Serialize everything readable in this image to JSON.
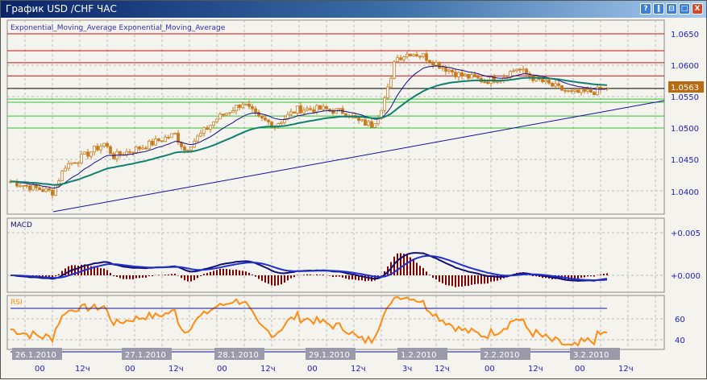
{
  "window": {
    "title": "График USD /CHF  ЧАС",
    "buttons": [
      "?",
      "‖",
      "⊟",
      "□",
      "X"
    ]
  },
  "colors": {
    "candle": "#c87818",
    "ema_fast": "#10108a",
    "ema_slow": "#108070",
    "resistance": "#d01010",
    "support": "#30c030",
    "trend": "#1010a0",
    "macd": "#101070",
    "signal": "#2030d0",
    "histogram": "#800000",
    "rsi": "#ff8c10",
    "rsi_over": "#ff20ff",
    "price_badge": "#b86a10"
  },
  "main_pane": {
    "legend": "Exponential_Moving_Average Exponential_Moving_Average",
    "price_ticks": [
      "1.0650",
      "1.0600",
      "1.0550",
      "1.0500",
      "1.0450",
      "1.0400"
    ],
    "current_price": "1.0563"
  },
  "macd_pane": {
    "label": "MACD",
    "ticks": [
      "+0.005",
      "+0.000"
    ]
  },
  "rsi_pane": {
    "label": "RSI",
    "ticks": [
      "60",
      "40"
    ]
  },
  "dates": [
    "26.1.2010",
    "27.1.2010",
    "28.1.2010",
    "29.1.2010",
    "1.2.2010",
    "2.2.2010",
    "3.2.2010"
  ],
  "times": [
    "00",
    "12ч",
    "00",
    "12ч",
    "00",
    "12ч",
    "00",
    "12ч",
    "3ч",
    "12ч",
    "00",
    "12ч",
    "00",
    "12ч"
  ],
  "chart_data": {
    "type": "candlestick",
    "symbol": "USD/CHF",
    "timeframe": "ЧАС",
    "ylim": [
      1.0375,
      1.0665
    ],
    "levels": {
      "red": [
        1.065,
        1.0623,
        1.0604,
        1.0583
      ],
      "black": [
        1.0563
      ],
      "green": [
        1.0546,
        1.0541,
        1.0519,
        1.05
      ]
    },
    "close_keypoints": [
      [
        0,
        1.0415
      ],
      [
        7,
        1.0405
      ],
      [
        13,
        1.0398
      ],
      [
        17,
        1.044
      ],
      [
        21,
        1.045
      ],
      [
        29,
        1.0475
      ],
      [
        32,
        1.0455
      ],
      [
        41,
        1.047
      ],
      [
        51,
        1.049
      ],
      [
        54,
        1.0465
      ],
      [
        64,
        1.0515
      ],
      [
        72,
        1.054
      ],
      [
        77,
        1.0515
      ],
      [
        82,
        1.0505
      ],
      [
        89,
        1.053
      ],
      [
        97,
        1.053
      ],
      [
        104,
        1.0525
      ],
      [
        108,
        1.051
      ],
      [
        112,
        1.0505
      ],
      [
        114,
        1.052
      ],
      [
        118,
        1.0575
      ],
      [
        119,
        1.061
      ],
      [
        124,
        1.062
      ],
      [
        128,
        1.0615
      ],
      [
        133,
        1.06
      ],
      [
        139,
        1.0585
      ],
      [
        147,
        1.0575
      ],
      [
        152,
        1.058
      ],
      [
        157,
        1.0595
      ],
      [
        162,
        1.058
      ],
      [
        169,
        1.0565
      ],
      [
        174,
        1.0555
      ],
      [
        181,
        1.0558
      ],
      [
        185,
        1.0563
      ]
    ],
    "rsi_levels": [
      70,
      30
    ]
  }
}
